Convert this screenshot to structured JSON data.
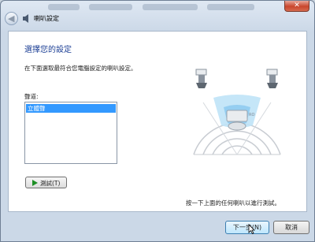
{
  "window": {
    "title": "喇叭設定",
    "close_label": "✕"
  },
  "heading": "選擇您的設定",
  "description": "在下面選取最符合您電腦設定的喇叭設定。",
  "list": {
    "label": "聲道:",
    "items": [
      "立體聲"
    ],
    "selected": "立體聲"
  },
  "test_button": {
    "label": "測試(T)"
  },
  "hint": "按一下上面的任何喇叭以進行測試。",
  "footer": {
    "next_label": "下一步(N)",
    "cancel_label": "取消"
  },
  "colors": {
    "heading": "#1c3f95",
    "selection": "#3399ff",
    "play_icon": "#1d8f25"
  }
}
